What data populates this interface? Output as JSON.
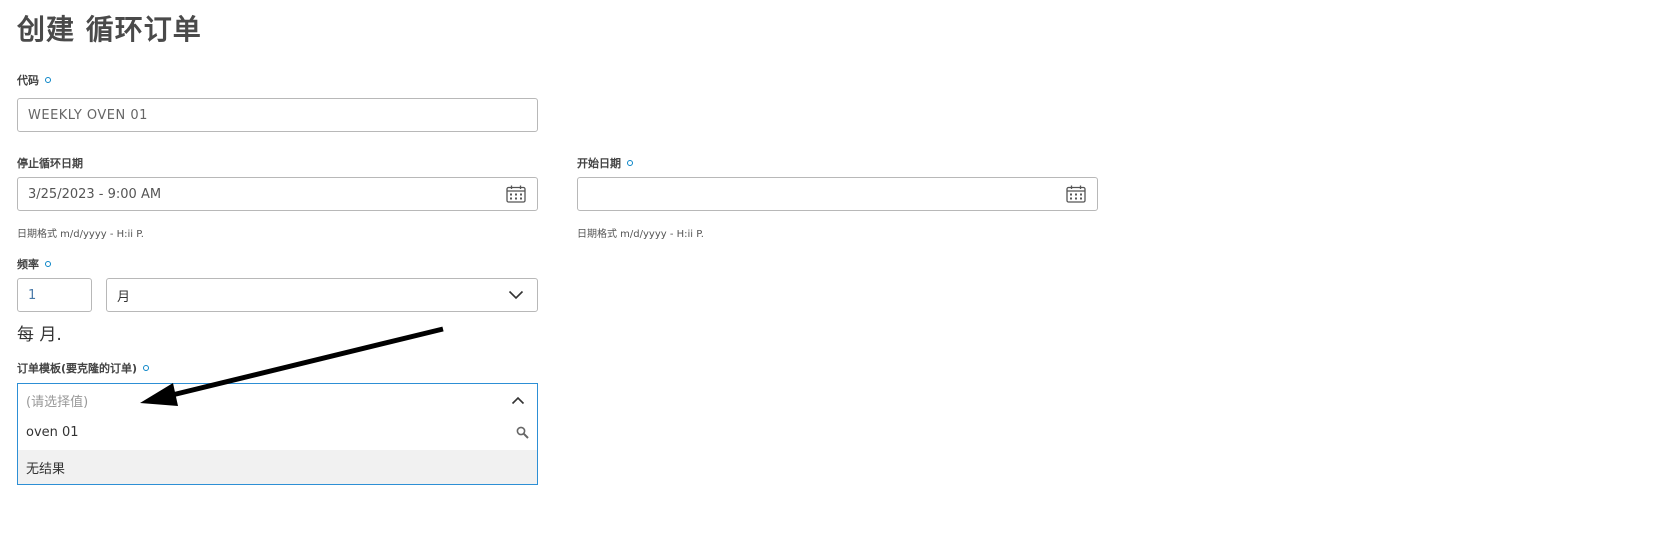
{
  "title": "创建 循环订单",
  "code": {
    "label": "代码",
    "value": "WEEKLY OVEN 01"
  },
  "stop_date": {
    "label": "停止循环日期",
    "value": "3/25/2023 - 9:00 AM",
    "hint": "日期格式 m/d/yyyy - H:ii P."
  },
  "start_date": {
    "label": "开始日期",
    "value": "",
    "hint": "日期格式 m/d/yyyy - H:ii P."
  },
  "frequency": {
    "label": "频率",
    "count": "1",
    "unit": "月",
    "summary": "每 月."
  },
  "order_template": {
    "label": "订单模板(要克隆的订单)",
    "placeholder": "(请选择值)",
    "search_text": "oven 01",
    "no_results": "无结果"
  },
  "colors": {
    "required_dot": "#0a85c7",
    "focus_border": "#2d8fd5",
    "annotation_arrow": "#000000"
  },
  "icons": [
    "calendar-icon",
    "chevron-down-icon",
    "chevron-up-icon",
    "search-icon",
    "annotation-arrow"
  ]
}
